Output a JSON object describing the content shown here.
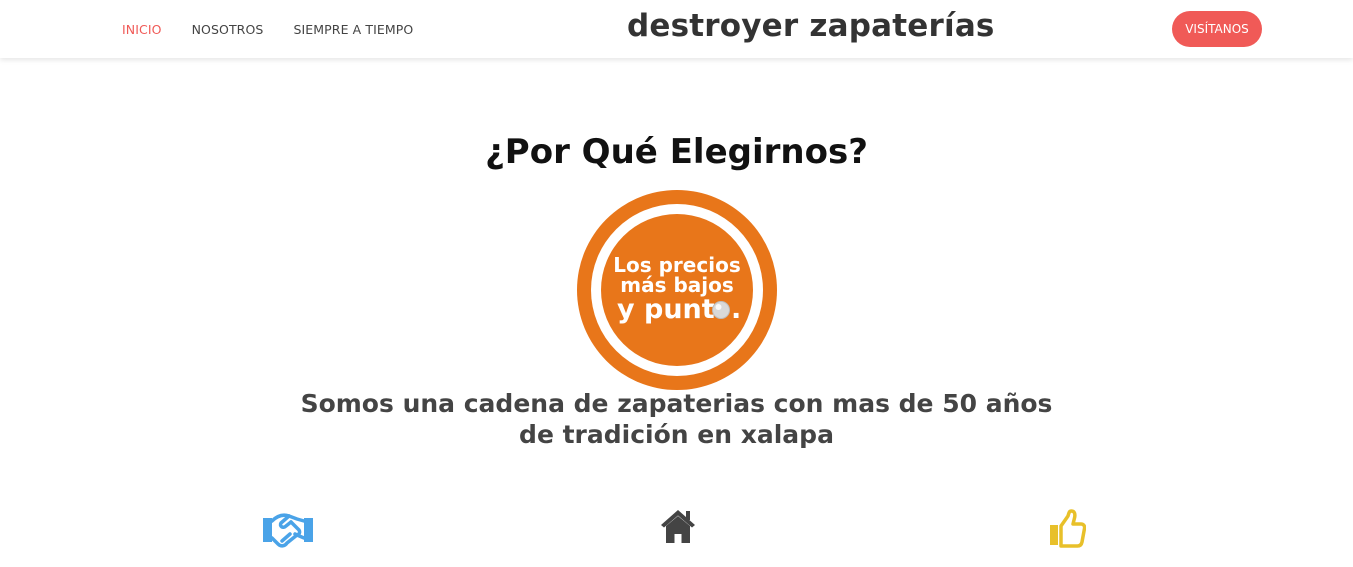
{
  "header": {
    "nav": [
      {
        "label": "INICIO",
        "active": true
      },
      {
        "label": "NOSOTROS",
        "active": false
      },
      {
        "label": "SIEMPRE A TIEMPO",
        "active": false
      }
    ],
    "brand": "destroyer zapaterías",
    "cta_label": "VISÍTANOS"
  },
  "main": {
    "title": "¿Por Qué Elegirnos?",
    "badge": {
      "line1": "Los precios",
      "line2": "más bajos",
      "line3_prefix": "y punt",
      "line3_suffix": "."
    },
    "tagline": "Somos una cadena de zapaterias con mas de 50 años de tradición en xalapa"
  },
  "features": [
    {
      "icon": "handshake-icon",
      "color": "#4aa3e8"
    },
    {
      "icon": "home-icon",
      "color": "#444444"
    },
    {
      "icon": "thumbs-up-icon",
      "color": "#e8c02a"
    }
  ],
  "colors": {
    "accent": "#f05a57",
    "badge_orange": "#e8761a",
    "text_dark": "#444444"
  }
}
